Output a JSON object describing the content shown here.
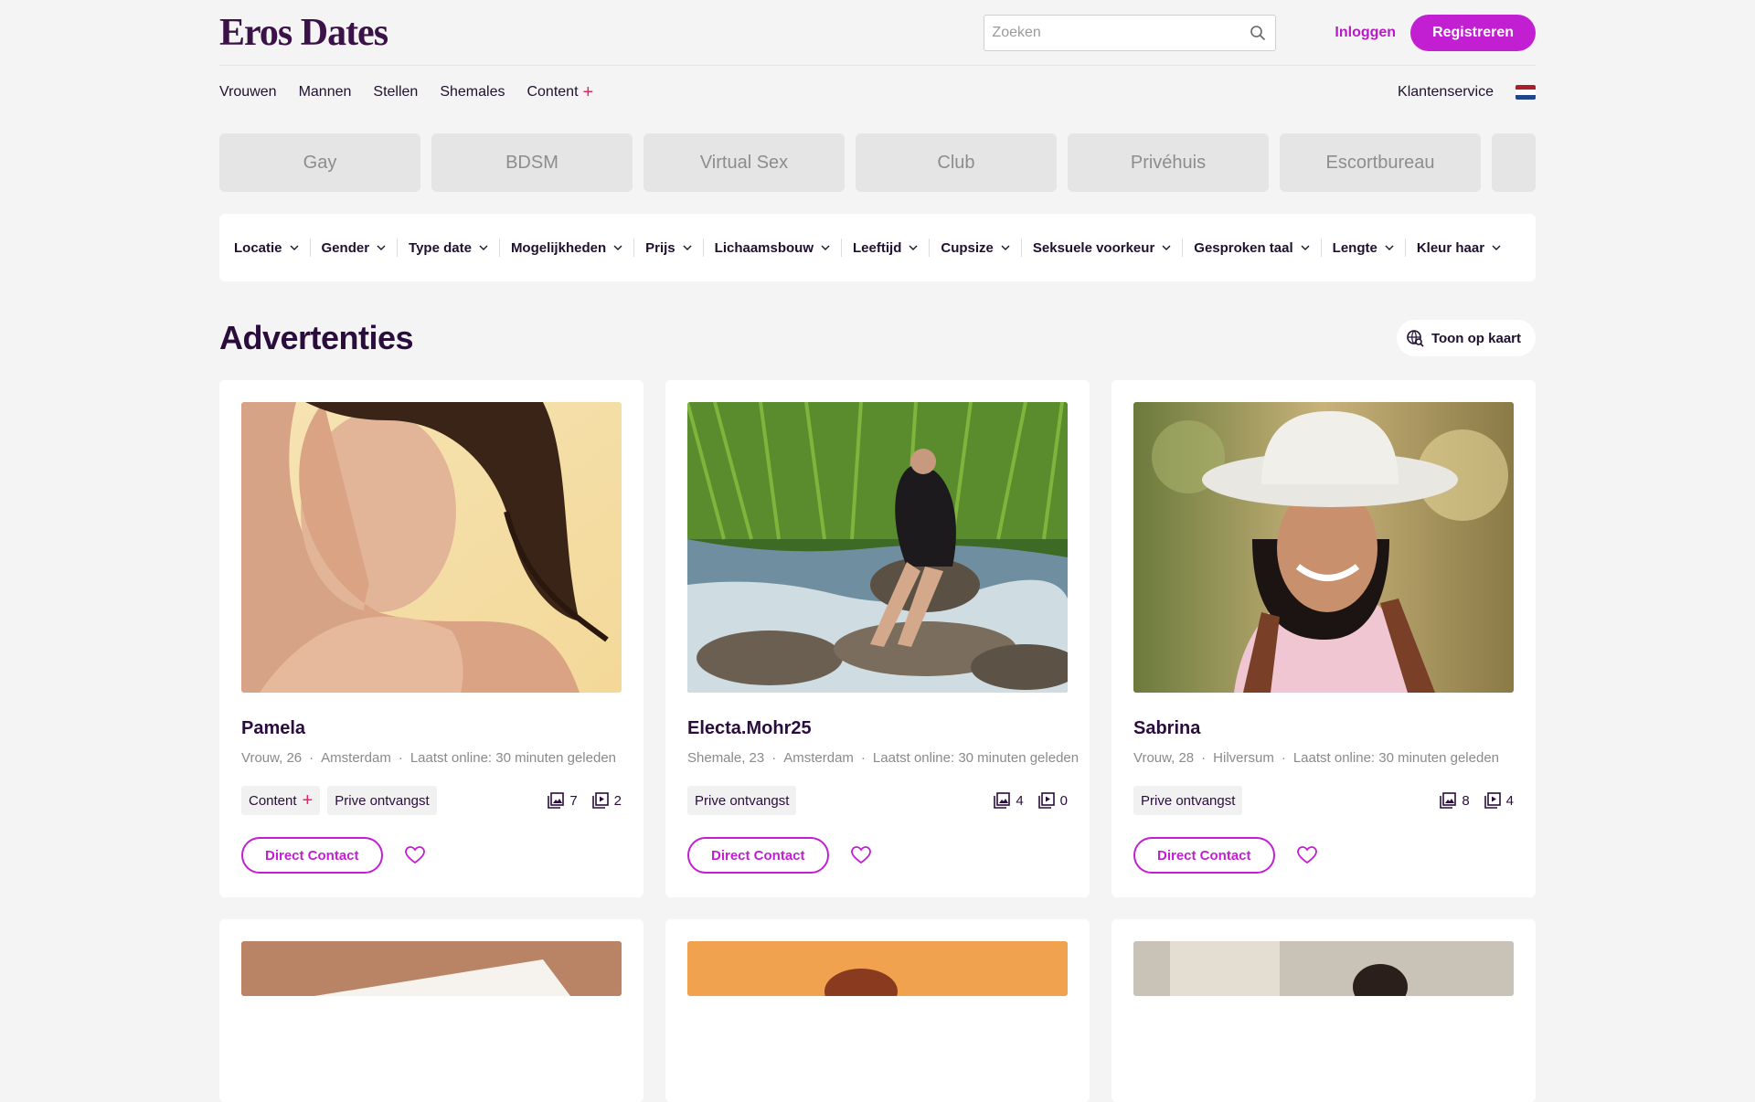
{
  "header": {
    "logo": "Eros Dates",
    "search_placeholder": "Zoeken",
    "login_label": "Inloggen",
    "register_label": "Registreren"
  },
  "nav": {
    "items": [
      {
        "label": "Vrouwen"
      },
      {
        "label": "Mannen"
      },
      {
        "label": "Stellen"
      },
      {
        "label": "Shemales"
      },
      {
        "label": "Content"
      }
    ],
    "service_label": "Klantenservice"
  },
  "categories": [
    "Gay",
    "BDSM",
    "Virtual Sex",
    "Club",
    "Privéhuis",
    "Escortbureau"
  ],
  "filters": [
    "Locatie",
    "Gender",
    "Type date",
    "Mogelijkheden",
    "Prijs",
    "Lichaamsbouw",
    "Leeftijd",
    "Cupsize",
    "Seksuele voorkeur",
    "Gesproken taal",
    "Lengte",
    "Kleur haar"
  ],
  "section": {
    "title": "Advertenties",
    "map_label": "Toon op kaart"
  },
  "cards": [
    {
      "name": "Pamela",
      "gender_age": "Vrouw, 26",
      "city": "Amsterdam",
      "online": "Laatst online: 30 minuten geleden",
      "tags": [
        "Content",
        "Prive ontvangst"
      ],
      "photos": "7",
      "videos": "2",
      "contact_label": "Direct Contact"
    },
    {
      "name": "Electa.Mohr25",
      "gender_age": "Shemale, 23",
      "city": "Amsterdam",
      "online": "Laatst online: 30 minuten geleden",
      "tags": [
        "Prive ontvangst"
      ],
      "photos": "4",
      "videos": "0",
      "contact_label": "Direct Contact"
    },
    {
      "name": "Sabrina",
      "gender_age": "Vrouw, 28",
      "city": "Hilversum",
      "online": "Laatst online: 30 minuten geleden",
      "tags": [
        "Prive ontvangst"
      ],
      "photos": "8",
      "videos": "4",
      "contact_label": "Direct Contact"
    }
  ],
  "colors": {
    "accent": "#c21fd3",
    "plus": "#e3236b",
    "title": "#2a0d3c"
  }
}
